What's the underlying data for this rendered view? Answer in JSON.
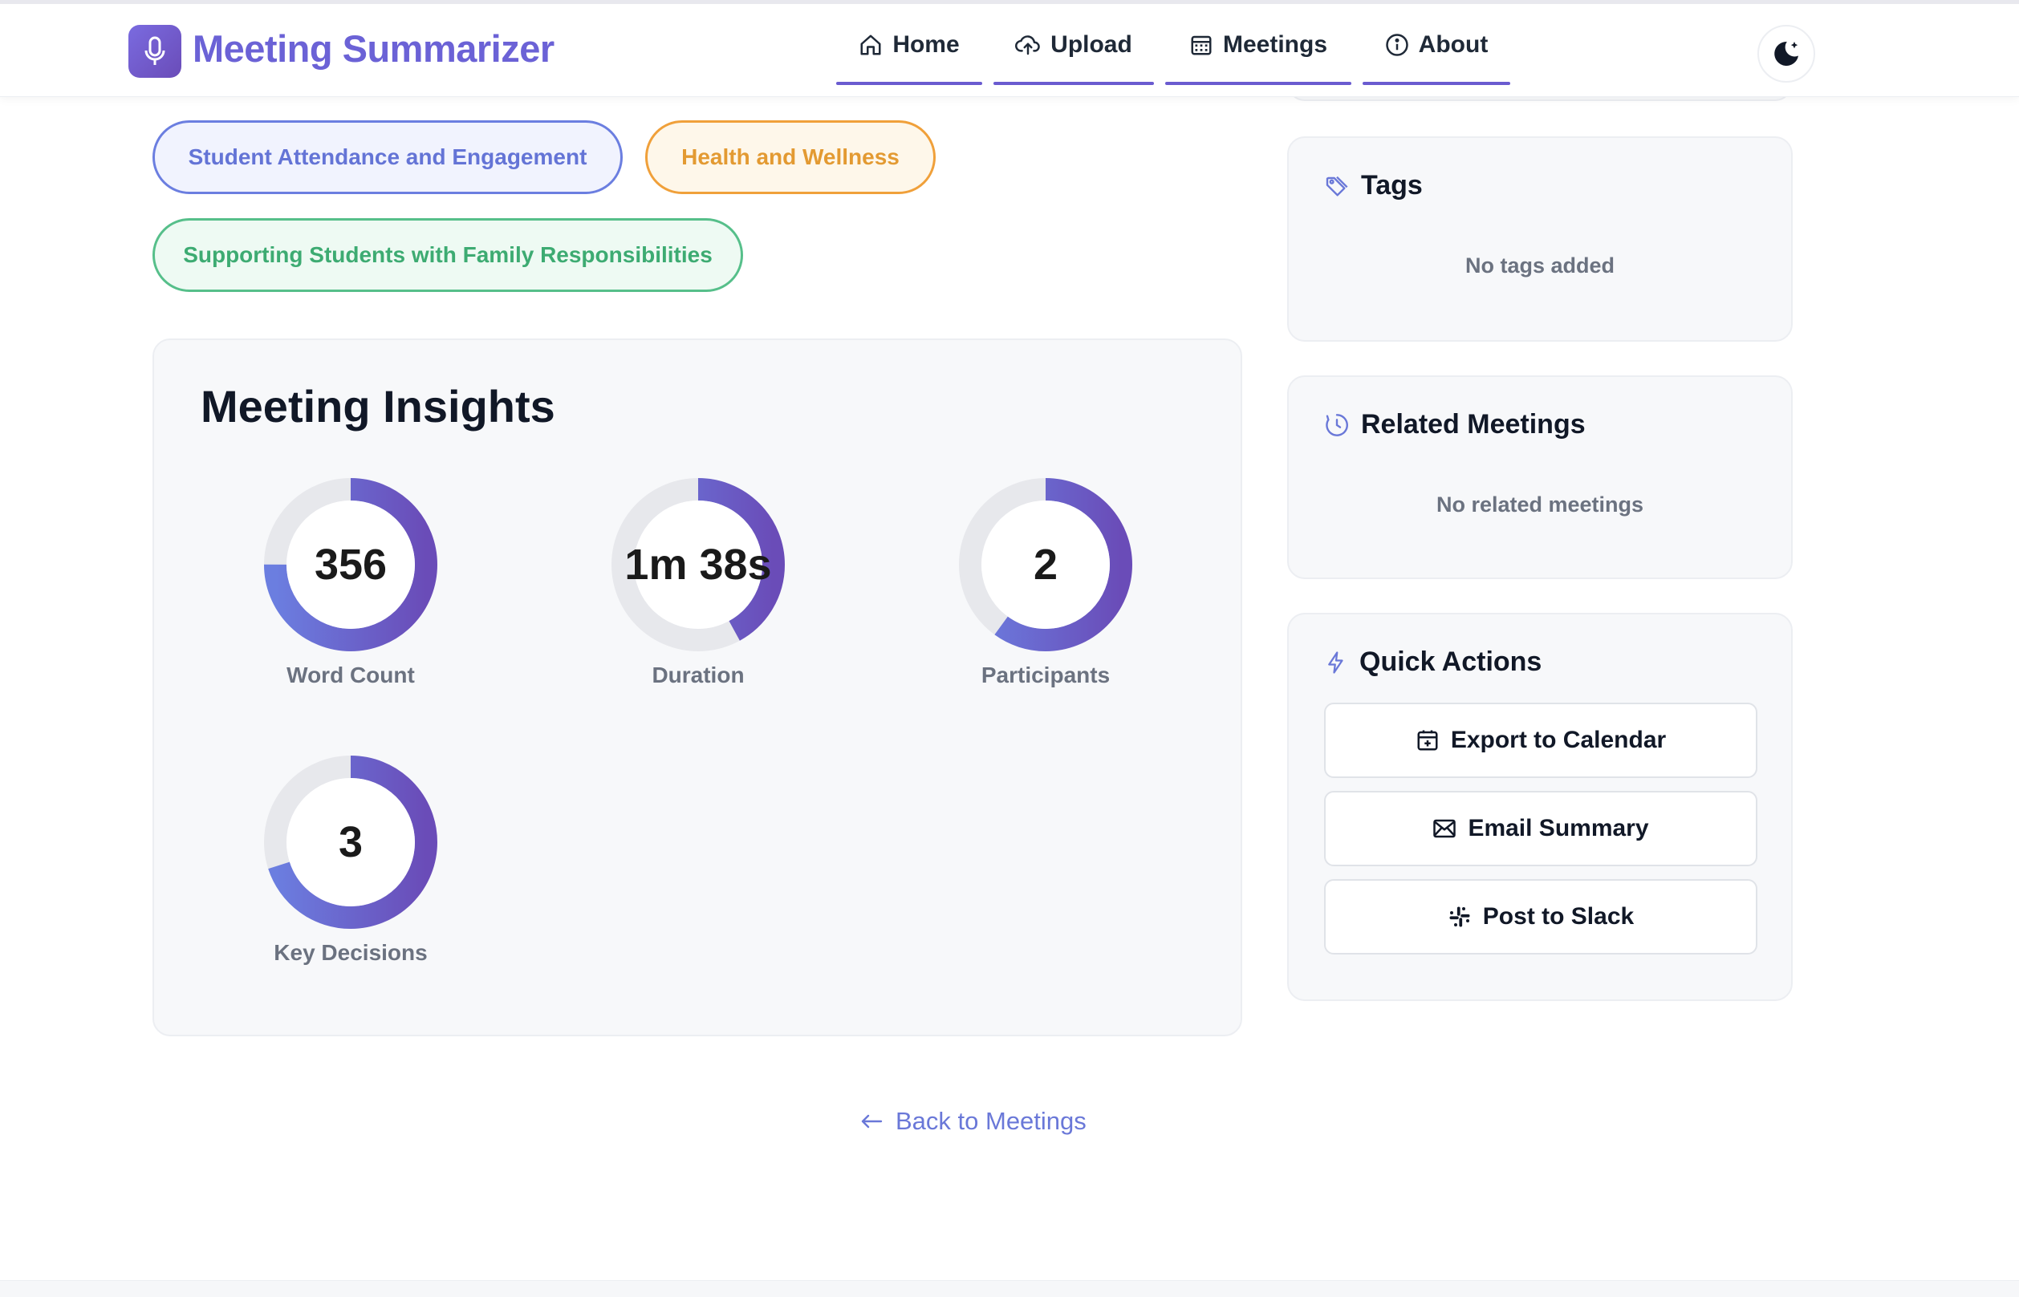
{
  "app": {
    "title": "Meeting Summarizer"
  },
  "nav": {
    "items": [
      {
        "label": "Home",
        "icon": "home-icon"
      },
      {
        "label": "Upload",
        "icon": "cloud-upload-icon"
      },
      {
        "label": "Meetings",
        "icon": "calendar-icon"
      },
      {
        "label": "About",
        "icon": "info-icon"
      }
    ],
    "theme_toggle_icon": "moon-stars-icon"
  },
  "topics": [
    {
      "label": "Student Attendance and Engagement",
      "color": "#6474d6"
    },
    {
      "label": "Health and Wellness",
      "color": "#e39a32"
    },
    {
      "label": "Supporting Students with Family Responsibilities",
      "color": "#3dab72"
    }
  ],
  "insights": {
    "title": "Meeting Insights",
    "metrics": [
      {
        "value": "356",
        "label": "Word Count",
        "fill": 0.75
      },
      {
        "value": "1m 38s",
        "label": "Duration",
        "fill": 0.42
      },
      {
        "value": "2",
        "label": "Participants",
        "fill": 0.6
      },
      {
        "value": "3",
        "label": "Key Decisions",
        "fill": 0.7
      }
    ]
  },
  "tags": {
    "title": "Tags",
    "empty": "No tags added"
  },
  "related": {
    "title": "Related Meetings",
    "empty": "No related meetings"
  },
  "quick_actions": {
    "title": "Quick Actions",
    "buttons": [
      {
        "label": "Export to Calendar",
        "icon": "calendar-plus-icon"
      },
      {
        "label": "Email Summary",
        "icon": "mail-icon"
      },
      {
        "label": "Post to Slack",
        "icon": "slack-icon"
      }
    ]
  },
  "back_link": "Back to Meetings",
  "colors": {
    "accent": "#6a5bd0",
    "ring_start": "#6b7ee0",
    "ring_end": "#6a4cb8",
    "ring_track": "#e7e8ec"
  }
}
